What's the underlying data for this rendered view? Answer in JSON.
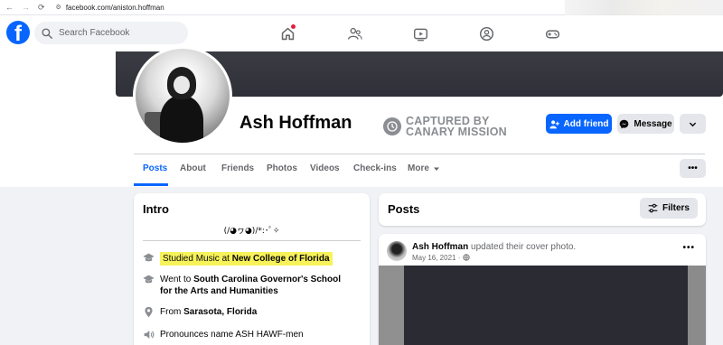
{
  "browser": {
    "url": "facebook.com/aniston.hoffman"
  },
  "topbar": {
    "logo": "f",
    "search_placeholder": "Search Facebook",
    "nav_icons": [
      "home-icon",
      "friends-icon",
      "video-icon",
      "groups-icon",
      "gaming-icon"
    ]
  },
  "profile": {
    "name": "Ash Hoffman",
    "overlay_line1": "CAPTURED BY",
    "overlay_line2": "CANARY MISSION",
    "add_friend_label": "Add friend",
    "message_label": "Message"
  },
  "tabs": {
    "items": [
      "Posts",
      "About",
      "Friends",
      "Photos",
      "Videos",
      "Check-ins",
      "More"
    ],
    "active": "Posts"
  },
  "intro": {
    "title": "Intro",
    "bio": "(/◕ヮ◕)/*:･ﾟ✧",
    "studied_prefix": "Studied Music at",
    "studied_school": "New College of Florida",
    "went_prefix": "Went to",
    "went_school": "South Carolina Governor's School for the Arts and Humanities",
    "from_prefix": "From",
    "from_place": "Sarasota, Florida",
    "pronounces": "Pronounces name ASH HAWF-men"
  },
  "posts": {
    "title": "Posts",
    "filters_label": "Filters",
    "post": {
      "author": "Ash Hoffman",
      "action": "updated their cover photo.",
      "date": "May 16, 2021",
      "separator": "·"
    }
  },
  "colors": {
    "brand": "#0866ff",
    "highlight": "#f7f25a",
    "notification": "#e41e3f"
  }
}
